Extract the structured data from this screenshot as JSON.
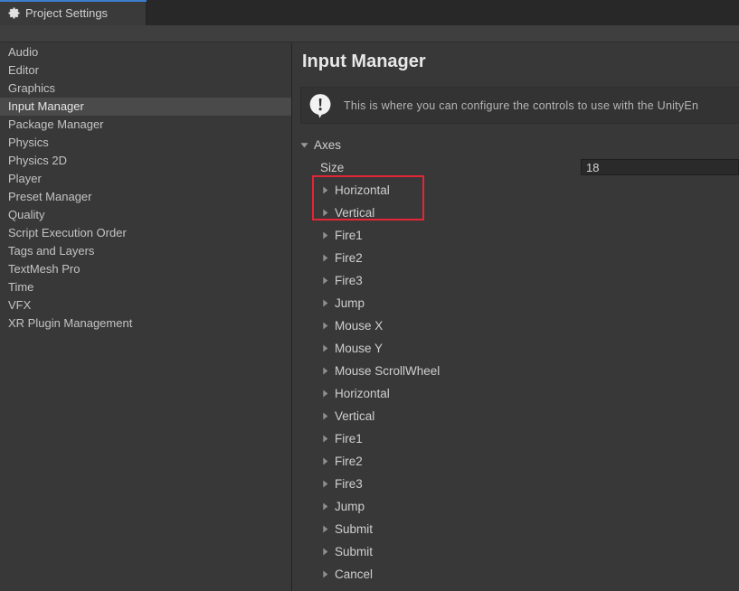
{
  "window": {
    "tab": {
      "label": "Project Settings",
      "icon": "gear-icon",
      "accent_color": "#3d7ecb"
    }
  },
  "sidebar": {
    "items": [
      {
        "label": "Audio",
        "selected": false
      },
      {
        "label": "Editor",
        "selected": false
      },
      {
        "label": "Graphics",
        "selected": false
      },
      {
        "label": "Input Manager",
        "selected": true
      },
      {
        "label": "Package Manager",
        "selected": false
      },
      {
        "label": "Physics",
        "selected": false
      },
      {
        "label": "Physics 2D",
        "selected": false
      },
      {
        "label": "Player",
        "selected": false
      },
      {
        "label": "Preset Manager",
        "selected": false
      },
      {
        "label": "Quality",
        "selected": false
      },
      {
        "label": "Script Execution Order",
        "selected": false
      },
      {
        "label": "Tags and Layers",
        "selected": false
      },
      {
        "label": "TextMesh Pro",
        "selected": false
      },
      {
        "label": "Time",
        "selected": false
      },
      {
        "label": "VFX",
        "selected": false
      },
      {
        "label": "XR Plugin Management",
        "selected": false
      }
    ]
  },
  "main": {
    "title": "Input Manager",
    "helpbox": {
      "icon": "info-exclamation-icon",
      "text": "This is where you can configure the controls to use with the UnityEn"
    },
    "axes": {
      "group_label": "Axes",
      "group_expanded": true,
      "size_label": "Size",
      "size_value": "18",
      "items": [
        {
          "label": "Horizontal",
          "expanded": false
        },
        {
          "label": "Vertical",
          "expanded": false
        },
        {
          "label": "Fire1",
          "expanded": false
        },
        {
          "label": "Fire2",
          "expanded": false
        },
        {
          "label": "Fire3",
          "expanded": false
        },
        {
          "label": "Jump",
          "expanded": false
        },
        {
          "label": "Mouse X",
          "expanded": false
        },
        {
          "label": "Mouse Y",
          "expanded": false
        },
        {
          "label": "Mouse ScrollWheel",
          "expanded": false
        },
        {
          "label": "Horizontal",
          "expanded": false
        },
        {
          "label": "Vertical",
          "expanded": false
        },
        {
          "label": "Fire1",
          "expanded": false
        },
        {
          "label": "Fire2",
          "expanded": false
        },
        {
          "label": "Fire3",
          "expanded": false
        },
        {
          "label": "Jump",
          "expanded": false
        },
        {
          "label": "Submit",
          "expanded": false
        },
        {
          "label": "Submit",
          "expanded": false
        },
        {
          "label": "Cancel",
          "expanded": false
        }
      ]
    }
  },
  "annotation": {
    "highlight_color": "#e32636"
  }
}
